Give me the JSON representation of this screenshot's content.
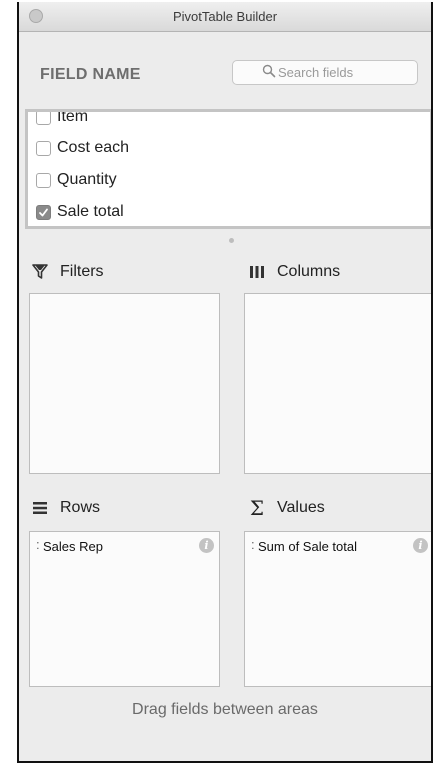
{
  "window": {
    "title": "PivotTable Builder"
  },
  "field_header": {
    "label": "FIELD NAME"
  },
  "search": {
    "placeholder": "Search fields"
  },
  "fields": [
    {
      "label": "Item",
      "checked": false
    },
    {
      "label": "Cost each",
      "checked": false
    },
    {
      "label": "Quantity",
      "checked": false
    },
    {
      "label": "Sale total",
      "checked": true
    }
  ],
  "areas": {
    "filters": {
      "label": "Filters",
      "icon": "filter-funnel-icon"
    },
    "columns": {
      "label": "Columns",
      "icon": "columns-bars-icon"
    },
    "rows": {
      "label": "Rows",
      "icon": "rows-lines-icon",
      "items": [
        {
          "label": "Sales Rep"
        }
      ]
    },
    "values": {
      "label": "Values",
      "icon": "sigma-icon",
      "items": [
        {
          "label": "Sum of Sale total"
        }
      ]
    }
  },
  "footer": {
    "hint": "Drag fields between areas"
  },
  "colors": {
    "panel_bg": "#ececec",
    "box_bg": "#fbfbfb",
    "checked_box": "#8a8a8a"
  }
}
